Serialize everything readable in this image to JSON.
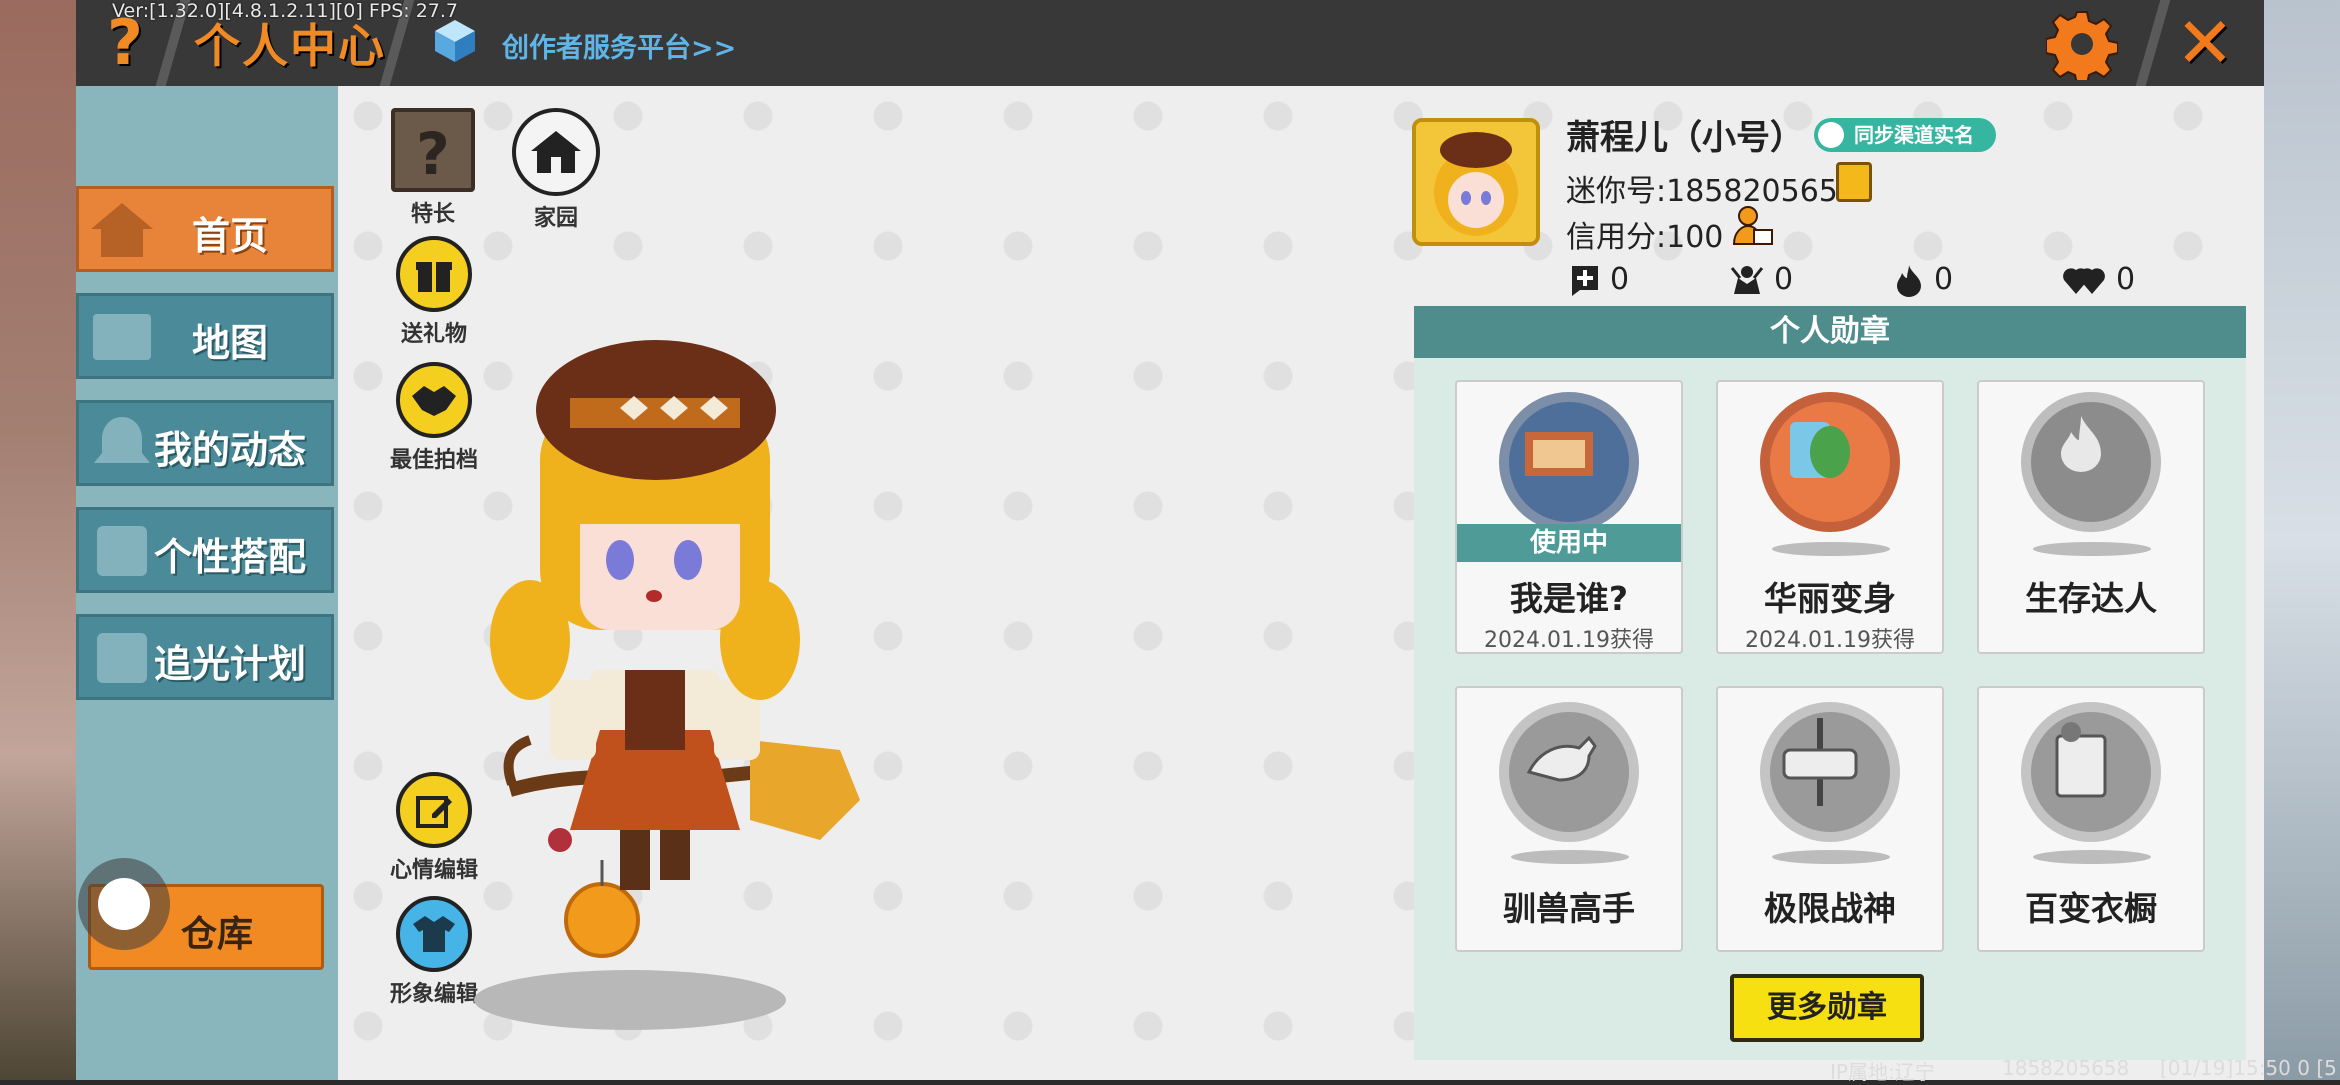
{
  "debug": {
    "version_line": "Ver:[1.32.0][4.8.1.2.11][0] FPS: 27.7"
  },
  "header": {
    "help_icon": "?",
    "title": "个人中心",
    "creator_link": "创作者服务平台>>",
    "close_icon": "✕",
    "accent_color": "#f08a24"
  },
  "nav": {
    "items": [
      {
        "label": "首页",
        "icon": "home-icon",
        "active": true
      },
      {
        "label": "地图",
        "icon": "map-icon",
        "active": false
      },
      {
        "label": "我的动态",
        "icon": "bell-icon",
        "active": false
      },
      {
        "label": "个性搭配",
        "icon": "outfit-icon",
        "active": false
      },
      {
        "label": "追光计划",
        "icon": "light-icon",
        "active": false
      }
    ],
    "warehouse_label": "仓库"
  },
  "tools": {
    "specialty": "特长",
    "specialty_glyph": "?",
    "homeland": "家园",
    "send_gift": "送礼物",
    "best_shot": "最佳拍档",
    "mood_edit": "心情编辑",
    "avatar_edit": "形象编辑"
  },
  "profile": {
    "name": "萧程儿（小号）",
    "sync_badge": "同步渠道实名",
    "mini_id": "迷你号:1858205658",
    "credit": "信用分:100",
    "stats": [
      {
        "icon": "add-friend-icon",
        "value": "0"
      },
      {
        "icon": "fans-icon",
        "value": "0"
      },
      {
        "icon": "fire-icon",
        "value": "0"
      },
      {
        "icon": "likes-icon",
        "value": "0"
      }
    ]
  },
  "medals": {
    "header": "个人勋章",
    "in_use_label": "使用中",
    "items": [
      {
        "name": "我是谁?",
        "date": "2024.01.19获得",
        "in_use": true,
        "earned": true
      },
      {
        "name": "华丽变身",
        "date": "2024.01.19获得",
        "in_use": false,
        "earned": true
      },
      {
        "name": "生存达人",
        "date": "",
        "in_use": false,
        "earned": false
      },
      {
        "name": "驯兽高手",
        "date": "",
        "in_use": false,
        "earned": false
      },
      {
        "name": "极限战神",
        "date": "",
        "in_use": false,
        "earned": false
      },
      {
        "name": "百变衣橱",
        "date": "",
        "in_use": false,
        "earned": false
      }
    ],
    "more_button": "更多勋章"
  },
  "footer": {
    "ip_location": "IP属地:辽宁",
    "uid": "1858205658",
    "timestamp": "[01/19]15:50 0 [5"
  }
}
